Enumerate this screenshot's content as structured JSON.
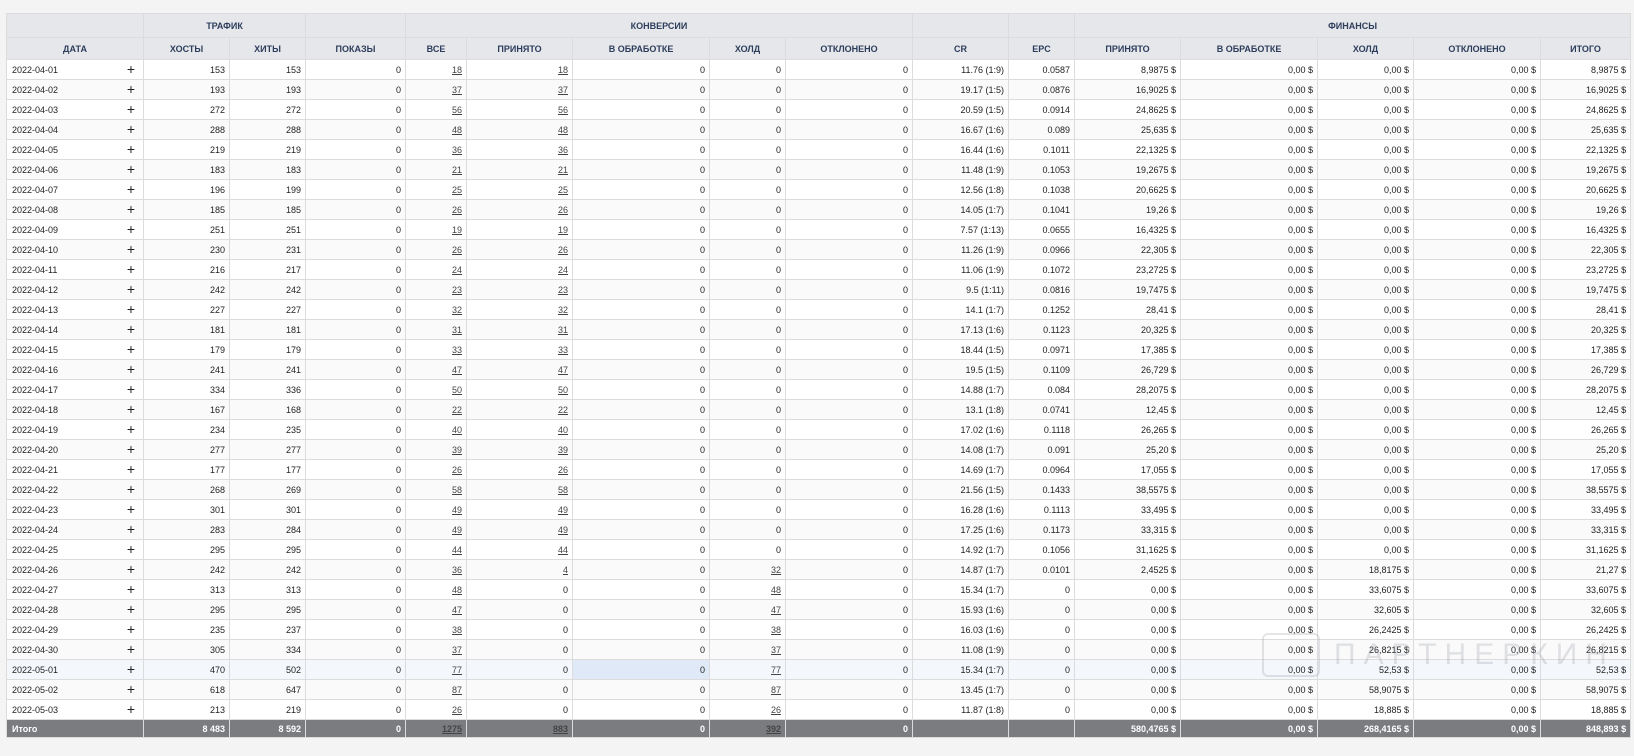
{
  "groups": {
    "traffic": "ТРАФИК",
    "conversions": "КОНВЕРСИИ",
    "finances": "ФИНАНСЫ"
  },
  "columns": [
    "ДАТА",
    "ХОСТЫ",
    "ХИТЫ",
    "ПОКАЗЫ",
    "ВСЕ",
    "ПРИНЯТО",
    "В ОБРАБОТКЕ",
    "ХОЛД",
    "ОТКЛОНЕНО",
    "CR",
    "EPC",
    "ПРИНЯТО",
    "В ОБРАБОТКЕ",
    "ХОЛД",
    "ОТКЛОНЕНО",
    "ИТОГО"
  ],
  "rows": [
    [
      "2022-04-01",
      "153",
      "153",
      "0",
      "18",
      "18",
      "0",
      "0",
      "0",
      "11.76 (1:9)",
      "0.0587",
      "8,9875 $",
      "0,00 $",
      "0,00 $",
      "0,00 $",
      "8,9875 $"
    ],
    [
      "2022-04-02",
      "193",
      "193",
      "0",
      "37",
      "37",
      "0",
      "0",
      "0",
      "19.17 (1:5)",
      "0.0876",
      "16,9025 $",
      "0,00 $",
      "0,00 $",
      "0,00 $",
      "16,9025 $"
    ],
    [
      "2022-04-03",
      "272",
      "272",
      "0",
      "56",
      "56",
      "0",
      "0",
      "0",
      "20.59 (1:5)",
      "0.0914",
      "24,8625 $",
      "0,00 $",
      "0,00 $",
      "0,00 $",
      "24,8625 $"
    ],
    [
      "2022-04-04",
      "288",
      "288",
      "0",
      "48",
      "48",
      "0",
      "0",
      "0",
      "16.67 (1:6)",
      "0.089",
      "25,635 $",
      "0,00 $",
      "0,00 $",
      "0,00 $",
      "25,635 $"
    ],
    [
      "2022-04-05",
      "219",
      "219",
      "0",
      "36",
      "36",
      "0",
      "0",
      "0",
      "16.44 (1:6)",
      "0.1011",
      "22,1325 $",
      "0,00 $",
      "0,00 $",
      "0,00 $",
      "22,1325 $"
    ],
    [
      "2022-04-06",
      "183",
      "183",
      "0",
      "21",
      "21",
      "0",
      "0",
      "0",
      "11.48 (1:9)",
      "0.1053",
      "19,2675 $",
      "0,00 $",
      "0,00 $",
      "0,00 $",
      "19,2675 $"
    ],
    [
      "2022-04-07",
      "196",
      "199",
      "0",
      "25",
      "25",
      "0",
      "0",
      "0",
      "12.56 (1:8)",
      "0.1038",
      "20,6625 $",
      "0,00 $",
      "0,00 $",
      "0,00 $",
      "20,6625 $"
    ],
    [
      "2022-04-08",
      "185",
      "185",
      "0",
      "26",
      "26",
      "0",
      "0",
      "0",
      "14.05 (1:7)",
      "0.1041",
      "19,26 $",
      "0,00 $",
      "0,00 $",
      "0,00 $",
      "19,26 $"
    ],
    [
      "2022-04-09",
      "251",
      "251",
      "0",
      "19",
      "19",
      "0",
      "0",
      "0",
      "7.57 (1:13)",
      "0.0655",
      "16,4325 $",
      "0,00 $",
      "0,00 $",
      "0,00 $",
      "16,4325 $"
    ],
    [
      "2022-04-10",
      "230",
      "231",
      "0",
      "26",
      "26",
      "0",
      "0",
      "0",
      "11.26 (1:9)",
      "0.0966",
      "22,305 $",
      "0,00 $",
      "0,00 $",
      "0,00 $",
      "22,305 $"
    ],
    [
      "2022-04-11",
      "216",
      "217",
      "0",
      "24",
      "24",
      "0",
      "0",
      "0",
      "11.06 (1:9)",
      "0.1072",
      "23,2725 $",
      "0,00 $",
      "0,00 $",
      "0,00 $",
      "23,2725 $"
    ],
    [
      "2022-04-12",
      "242",
      "242",
      "0",
      "23",
      "23",
      "0",
      "0",
      "0",
      "9.5 (1:11)",
      "0.0816",
      "19,7475 $",
      "0,00 $",
      "0,00 $",
      "0,00 $",
      "19,7475 $"
    ],
    [
      "2022-04-13",
      "227",
      "227",
      "0",
      "32",
      "32",
      "0",
      "0",
      "0",
      "14.1 (1:7)",
      "0.1252",
      "28,41 $",
      "0,00 $",
      "0,00 $",
      "0,00 $",
      "28,41 $"
    ],
    [
      "2022-04-14",
      "181",
      "181",
      "0",
      "31",
      "31",
      "0",
      "0",
      "0",
      "17.13 (1:6)",
      "0.1123",
      "20,325 $",
      "0,00 $",
      "0,00 $",
      "0,00 $",
      "20,325 $"
    ],
    [
      "2022-04-15",
      "179",
      "179",
      "0",
      "33",
      "33",
      "0",
      "0",
      "0",
      "18.44 (1:5)",
      "0.0971",
      "17,385 $",
      "0,00 $",
      "0,00 $",
      "0,00 $",
      "17,385 $"
    ],
    [
      "2022-04-16",
      "241",
      "241",
      "0",
      "47",
      "47",
      "0",
      "0",
      "0",
      "19.5 (1:5)",
      "0.1109",
      "26,729 $",
      "0,00 $",
      "0,00 $",
      "0,00 $",
      "26,729 $"
    ],
    [
      "2022-04-17",
      "334",
      "336",
      "0",
      "50",
      "50",
      "0",
      "0",
      "0",
      "14.88 (1:7)",
      "0.084",
      "28,2075 $",
      "0,00 $",
      "0,00 $",
      "0,00 $",
      "28,2075 $"
    ],
    [
      "2022-04-18",
      "167",
      "168",
      "0",
      "22",
      "22",
      "0",
      "0",
      "0",
      "13.1 (1:8)",
      "0.0741",
      "12,45 $",
      "0,00 $",
      "0,00 $",
      "0,00 $",
      "12,45 $"
    ],
    [
      "2022-04-19",
      "234",
      "235",
      "0",
      "40",
      "40",
      "0",
      "0",
      "0",
      "17.02 (1:6)",
      "0.1118",
      "26,265 $",
      "0,00 $",
      "0,00 $",
      "0,00 $",
      "26,265 $"
    ],
    [
      "2022-04-20",
      "277",
      "277",
      "0",
      "39",
      "39",
      "0",
      "0",
      "0",
      "14.08 (1:7)",
      "0.091",
      "25,20 $",
      "0,00 $",
      "0,00 $",
      "0,00 $",
      "25,20 $"
    ],
    [
      "2022-04-21",
      "177",
      "177",
      "0",
      "26",
      "26",
      "0",
      "0",
      "0",
      "14.69 (1:7)",
      "0.0964",
      "17,055 $",
      "0,00 $",
      "0,00 $",
      "0,00 $",
      "17,055 $"
    ],
    [
      "2022-04-22",
      "268",
      "269",
      "0",
      "58",
      "58",
      "0",
      "0",
      "0",
      "21.56 (1:5)",
      "0.1433",
      "38,5575 $",
      "0,00 $",
      "0,00 $",
      "0,00 $",
      "38,5575 $"
    ],
    [
      "2022-04-23",
      "301",
      "301",
      "0",
      "49",
      "49",
      "0",
      "0",
      "0",
      "16.28 (1:6)",
      "0.1113",
      "33,495 $",
      "0,00 $",
      "0,00 $",
      "0,00 $",
      "33,495 $"
    ],
    [
      "2022-04-24",
      "283",
      "284",
      "0",
      "49",
      "49",
      "0",
      "0",
      "0",
      "17.25 (1:6)",
      "0.1173",
      "33,315 $",
      "0,00 $",
      "0,00 $",
      "0,00 $",
      "33,315 $"
    ],
    [
      "2022-04-25",
      "295",
      "295",
      "0",
      "44",
      "44",
      "0",
      "0",
      "0",
      "14.92 (1:7)",
      "0.1056",
      "31,1625 $",
      "0,00 $",
      "0,00 $",
      "0,00 $",
      "31,1625 $"
    ],
    [
      "2022-04-26",
      "242",
      "242",
      "0",
      "36",
      "4",
      "0",
      "32",
      "0",
      "14.87 (1:7)",
      "0.0101",
      "2,4525 $",
      "0,00 $",
      "18,8175 $",
      "0,00 $",
      "21,27 $"
    ],
    [
      "2022-04-27",
      "313",
      "313",
      "0",
      "48",
      "0",
      "0",
      "48",
      "0",
      "15.34 (1:7)",
      "0",
      "0,00 $",
      "0,00 $",
      "33,6075 $",
      "0,00 $",
      "33,6075 $"
    ],
    [
      "2022-04-28",
      "295",
      "295",
      "0",
      "47",
      "0",
      "0",
      "47",
      "0",
      "15.93 (1:6)",
      "0",
      "0,00 $",
      "0,00 $",
      "32,605 $",
      "0,00 $",
      "32,605 $"
    ],
    [
      "2022-04-29",
      "235",
      "237",
      "0",
      "38",
      "0",
      "0",
      "38",
      "0",
      "16.03 (1:6)",
      "0",
      "0,00 $",
      "0,00 $",
      "26,2425 $",
      "0,00 $",
      "26,2425 $"
    ],
    [
      "2022-04-30",
      "305",
      "334",
      "0",
      "37",
      "0",
      "0",
      "37",
      "0",
      "11.08 (1:9)",
      "0",
      "0,00 $",
      "0,00 $",
      "26,8215 $",
      "0,00 $",
      "26,8215 $"
    ],
    [
      "2022-05-01",
      "470",
      "502",
      "0",
      "77",
      "0",
      "0",
      "77",
      "0",
      "15.34 (1:7)",
      "0",
      "0,00 $",
      "0,00 $",
      "52,53 $",
      "0,00 $",
      "52,53 $"
    ],
    [
      "2022-05-02",
      "618",
      "647",
      "0",
      "87",
      "0",
      "0",
      "87",
      "0",
      "13.45 (1:7)",
      "0",
      "0,00 $",
      "0,00 $",
      "58,9075 $",
      "0,00 $",
      "58,9075 $"
    ],
    [
      "2022-05-03",
      "213",
      "219",
      "0",
      "26",
      "0",
      "0",
      "26",
      "0",
      "11.87 (1:8)",
      "0",
      "0,00 $",
      "0,00 $",
      "18,885 $",
      "0,00 $",
      "18,885 $"
    ]
  ],
  "totals": [
    "Итого",
    "8 483",
    "8 592",
    "0",
    "1275",
    "883",
    "0",
    "392",
    "0",
    "",
    "",
    "580,4765 $",
    "0,00 $",
    "268,4165 $",
    "0,00 $",
    "848,893 $"
  ],
  "row_action_icon": "+",
  "highlighted_row_index": 30,
  "selected_cell_column": 6,
  "watermark_text": "ПАРТНЕРКИН",
  "colors": {
    "header_bg": "#e6e7ea",
    "header_text": "#2d3d5c",
    "totals_bg": "#7b7c80",
    "selection": "#dfe9f7"
  }
}
